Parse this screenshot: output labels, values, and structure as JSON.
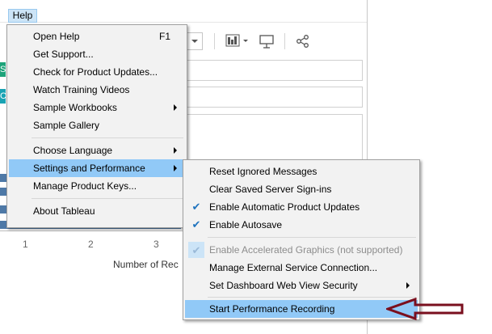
{
  "menubar": {
    "help_label": "Help"
  },
  "background": {
    "pill_s": "S",
    "pill_c": "C",
    "axis_ticks": [
      "1",
      "2",
      "3"
    ],
    "axis_title": "Number of Rec"
  },
  "help_menu": {
    "items": [
      {
        "label": "Open Help",
        "shortcut": "F1"
      },
      {
        "label": "Get Support..."
      },
      {
        "label": "Check for Product Updates..."
      },
      {
        "label": "Watch Training Videos"
      },
      {
        "label": "Sample Workbooks"
      },
      {
        "label": "Sample Gallery"
      },
      {
        "label": "Choose Language"
      },
      {
        "label": "Settings and Performance"
      },
      {
        "label": "Manage Product Keys..."
      },
      {
        "label": "About Tableau"
      }
    ]
  },
  "settings_menu": {
    "items": [
      {
        "label": "Reset Ignored Messages",
        "checked": false
      },
      {
        "label": "Clear Saved Server Sign-ins",
        "checked": false
      },
      {
        "label": "Enable Automatic Product Updates",
        "checked": true
      },
      {
        "label": "Enable Autosave",
        "checked": true
      },
      {
        "label": "Enable Accelerated Graphics (not supported)",
        "checked": true,
        "disabled": true
      },
      {
        "label": "Manage External Service Connection...",
        "checked": false
      },
      {
        "label": "Set Dashboard Web View Security",
        "checked": false
      },
      {
        "label": "Start Performance Recording",
        "checked": false
      }
    ]
  },
  "colors": {
    "highlight": "#91c9f7",
    "bar": "#4e79a7",
    "pill_green": "#1da37a",
    "pill_teal": "#19a3b3",
    "annotation_arrow": "#7a0f1e"
  },
  "icons": [
    "chevron-down-icon",
    "bar-chart-icon",
    "presentation-icon",
    "share-icon",
    "check-icon",
    "submenu-arrow-icon",
    "annotation-arrow-icon"
  ]
}
